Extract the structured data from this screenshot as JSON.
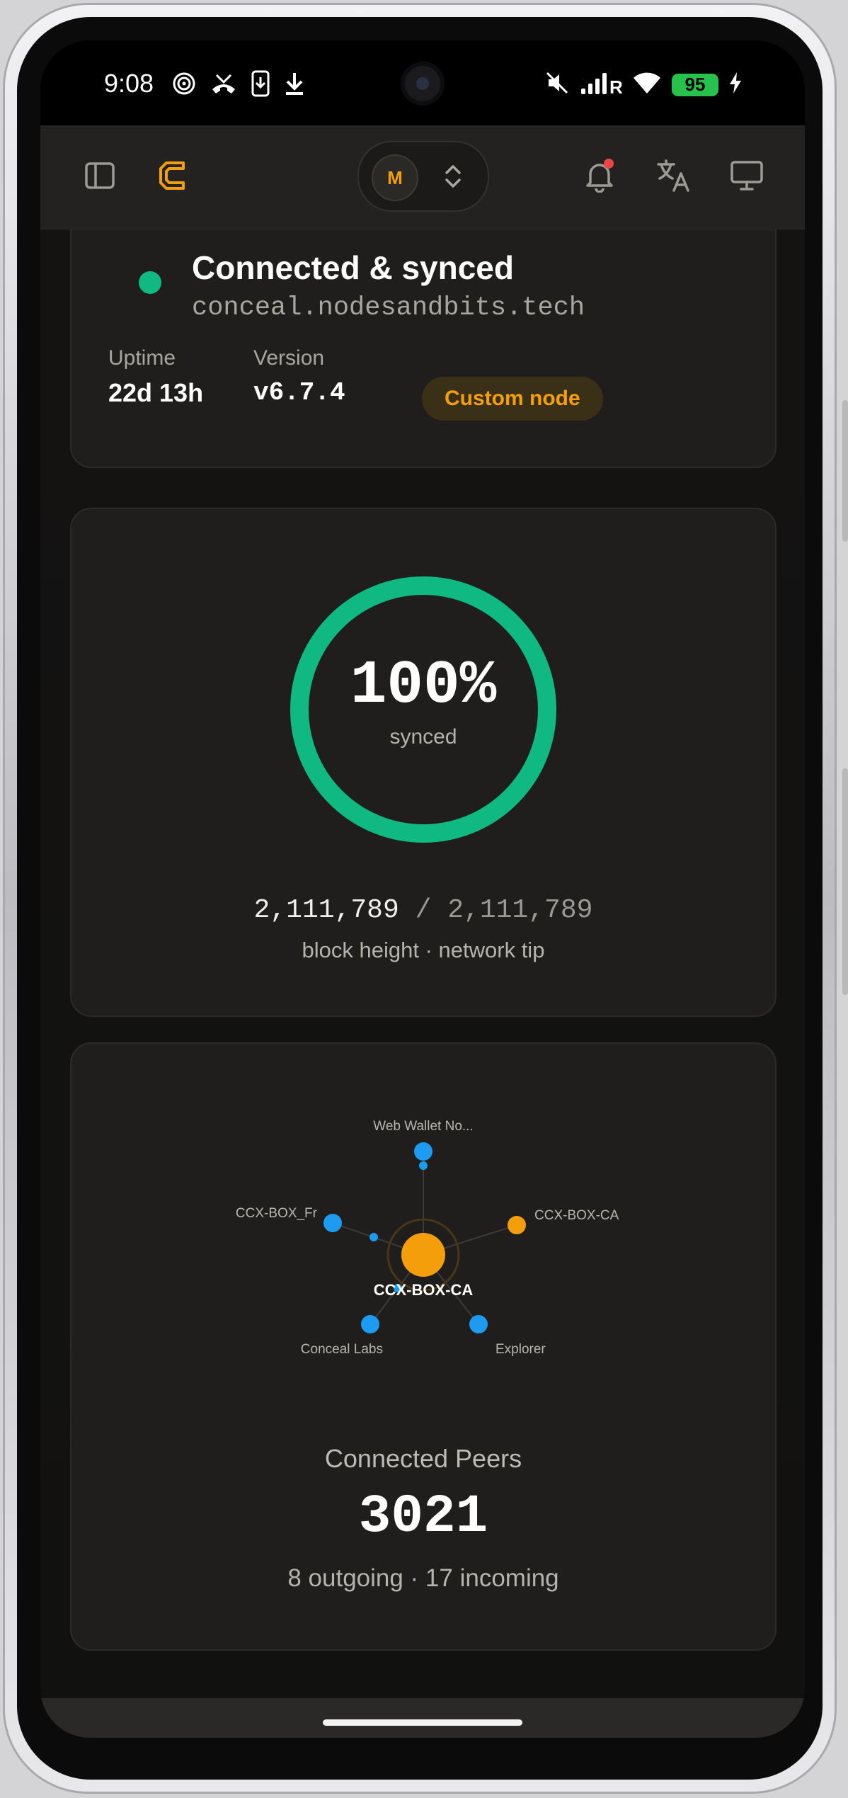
{
  "status_bar": {
    "time": "9:08",
    "battery_level": "95"
  },
  "header": {
    "account_initial": "M"
  },
  "connection": {
    "title": "Connected & synced",
    "host": "conceal.nodesandbits.tech",
    "uptime_label": "Uptime",
    "uptime_value": "22d 13h",
    "version_label": "Version",
    "version_value": "v6.7.4",
    "node_badge": "Custom node",
    "status_color": "#10b981"
  },
  "sync": {
    "percent_text": "100%",
    "percent_value": 100,
    "label": "synced",
    "block_height": "2,111,789",
    "separator": "/",
    "network_tip": "2,111,789",
    "caption": "block height · network tip",
    "ring_color": "#10b981"
  },
  "peers": {
    "center_node": "CCX-BOX-CA",
    "nodes": [
      "Web Wallet No...",
      "CCX-BOX-CA",
      "Explorer",
      "Conceal Labs",
      "CCX-BOX_Fr"
    ],
    "title": "Connected Peers",
    "count": "3021",
    "summary": "8 outgoing · 17 incoming",
    "colors": {
      "center": "#f59e0b",
      "outgoing": "#1d9bf0",
      "incoming": "#f59e0b"
    }
  },
  "theme": {
    "accent": "#f59e0b",
    "background": "#111110",
    "card": "#1f1e1c"
  }
}
